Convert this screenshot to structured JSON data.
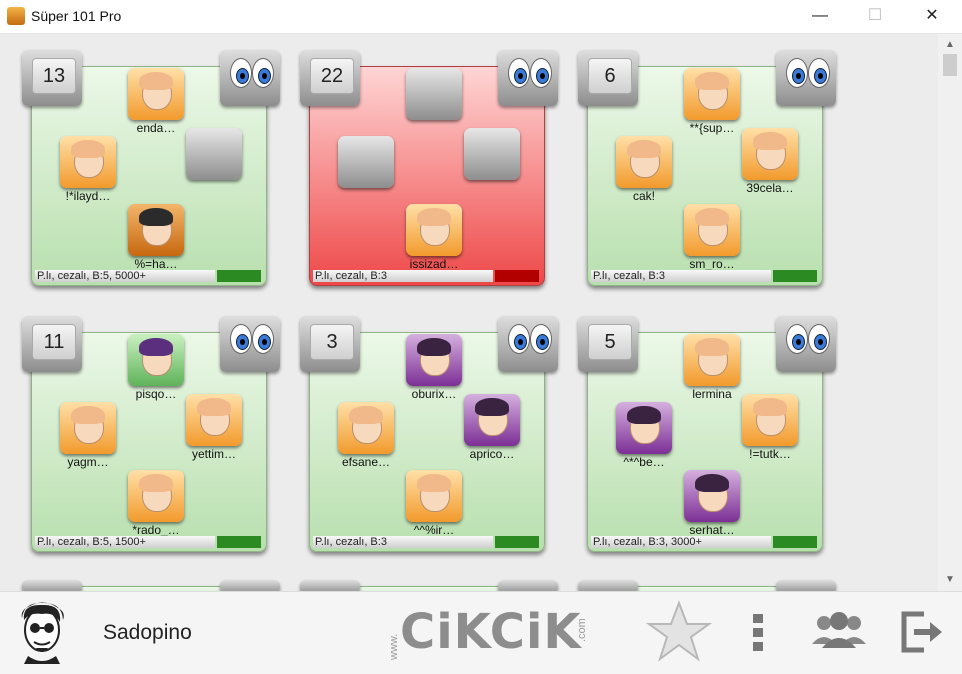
{
  "window": {
    "title": "Süper 101 Pro",
    "minimize": "—",
    "maximize": "☐",
    "close": "✕"
  },
  "scroll": {
    "up": "▲",
    "down": "▼"
  },
  "tables": [
    {
      "number": "13",
      "status": "green",
      "seats": [
        {
          "pos": "top",
          "name": "enda…",
          "avatar": "orange"
        },
        {
          "pos": "left",
          "name": "!*ilayd…",
          "avatar": "orange"
        },
        {
          "pos": "right",
          "name": "",
          "avatar": "empty"
        },
        {
          "pos": "bottom",
          "name": "%=ha…",
          "avatar": "darkorange"
        }
      ],
      "info": "P.lı, cezalı, B:5, 5000+"
    },
    {
      "number": "22",
      "status": "red",
      "seats": [
        {
          "pos": "top",
          "name": "",
          "avatar": "empty"
        },
        {
          "pos": "left",
          "name": "",
          "avatar": "empty"
        },
        {
          "pos": "right",
          "name": "",
          "avatar": "empty"
        },
        {
          "pos": "bottom",
          "name": "issizad…",
          "avatar": "orange"
        }
      ],
      "info": "P.lı, cezalı, B:3"
    },
    {
      "number": "6",
      "status": "green",
      "seats": [
        {
          "pos": "top",
          "name": "**{sup…",
          "avatar": "orange"
        },
        {
          "pos": "left",
          "name": "cak!",
          "avatar": "orange"
        },
        {
          "pos": "right",
          "name": "39cela…",
          "avatar": "orange"
        },
        {
          "pos": "bottom",
          "name": "sm_ro…",
          "avatar": "orange"
        }
      ],
      "info": "P.lı, cezalı, B:3"
    },
    {
      "number": "11",
      "status": "green",
      "seats": [
        {
          "pos": "top",
          "name": "pisqo…",
          "avatar": "green"
        },
        {
          "pos": "left",
          "name": "yagm…",
          "avatar": "orange"
        },
        {
          "pos": "right",
          "name": "yettim…",
          "avatar": "orange"
        },
        {
          "pos": "bottom",
          "name": "*rado_…",
          "avatar": "orange"
        }
      ],
      "info": "P.lı, cezalı, B:5, 1500+"
    },
    {
      "number": "3",
      "status": "green",
      "seats": [
        {
          "pos": "top",
          "name": "oburix…",
          "avatar": "purple"
        },
        {
          "pos": "left",
          "name": "efsane…",
          "avatar": "orange"
        },
        {
          "pos": "right",
          "name": "aprico…",
          "avatar": "purple"
        },
        {
          "pos": "bottom",
          "name": "^^%ir…",
          "avatar": "orange"
        }
      ],
      "info": "P.lı, cezalı, B:3"
    },
    {
      "number": "5",
      "status": "green",
      "seats": [
        {
          "pos": "top",
          "name": "lermina",
          "avatar": "orange"
        },
        {
          "pos": "left",
          "name": "^*^be…",
          "avatar": "purple"
        },
        {
          "pos": "right",
          "name": "!=tutk…",
          "avatar": "orange"
        },
        {
          "pos": "bottom",
          "name": "serhat…",
          "avatar": "purple"
        }
      ],
      "info": "P.lı, cezalı, B:3, 3000+"
    }
  ],
  "footer": {
    "username": "Sadopino",
    "logo_text": "CiKCiK",
    "logo_prefix": "www.",
    "logo_suffix": ".com"
  }
}
